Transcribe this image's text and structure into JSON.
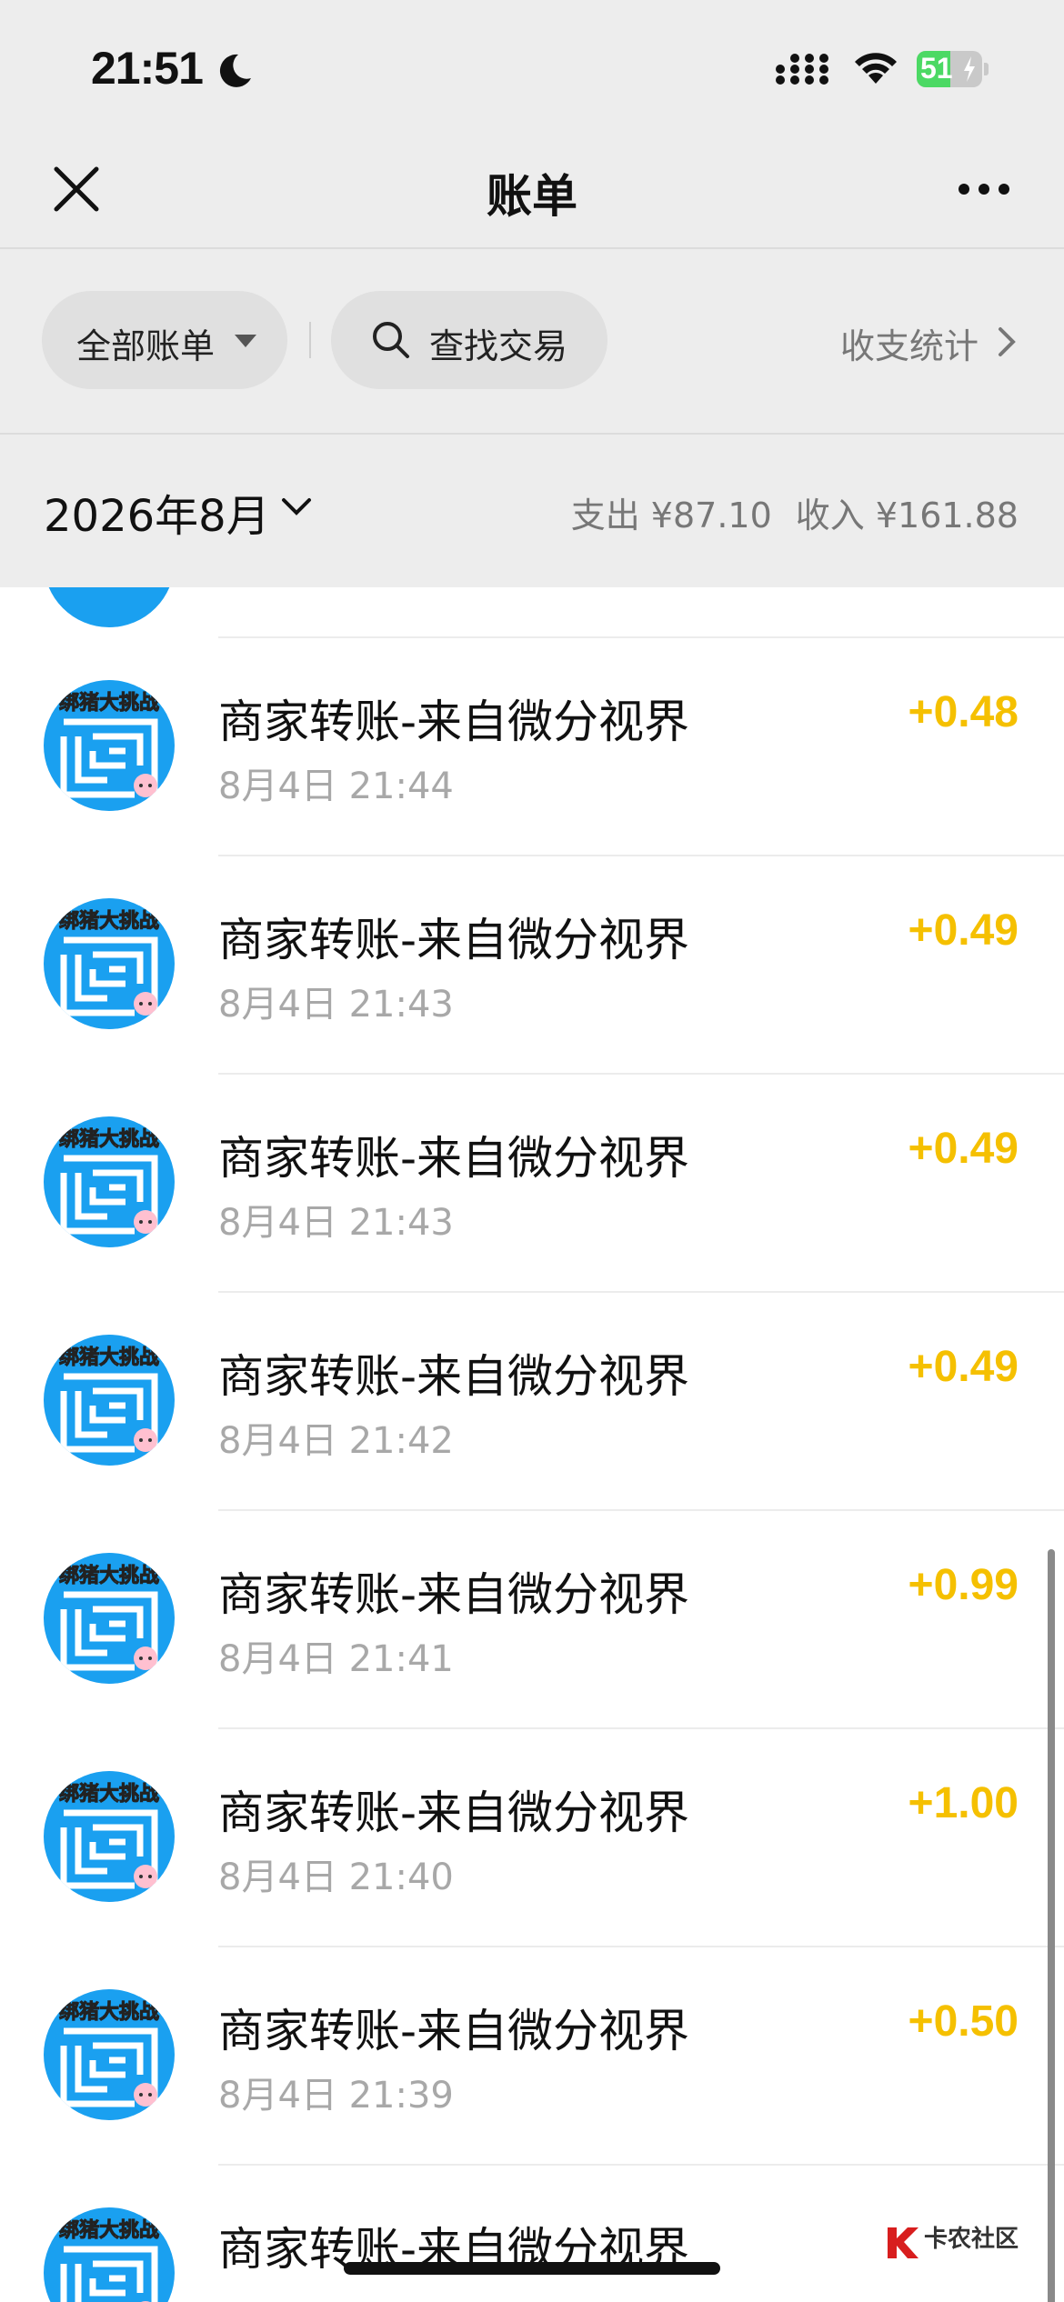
{
  "status": {
    "time": "21:51",
    "battery": "51",
    "battery_level": 0.51
  },
  "nav": {
    "title": "账单"
  },
  "filters": {
    "all_bills": "全部账单",
    "search": "查找交易",
    "stats": "收支统计"
  },
  "month": {
    "label": "2026年8月",
    "expense": "支出 ¥87.10",
    "income": "收入 ¥161.88"
  },
  "transactions": [
    {
      "title": "商家转账-来自微分视界",
      "time": "8月4日 21:44",
      "amount": "+0.48"
    },
    {
      "title": "商家转账-来自微分视界",
      "time": "8月4日 21:43",
      "amount": "+0.49"
    },
    {
      "title": "商家转账-来自微分视界",
      "time": "8月4日 21:43",
      "amount": "+0.49"
    },
    {
      "title": "商家转账-来自微分视界",
      "time": "8月4日 21:42",
      "amount": "+0.49"
    },
    {
      "title": "商家转账-来自微分视界",
      "time": "8月4日 21:41",
      "amount": "+0.99"
    },
    {
      "title": "商家转账-来自微分视界",
      "time": "8月4日 21:40",
      "amount": "+1.00"
    },
    {
      "title": "商家转账-来自微分视界",
      "time": "8月4日 21:39",
      "amount": "+0.50"
    },
    {
      "title": "商家转账-来自微分视界",
      "time": "",
      "amount": ""
    }
  ],
  "avatar_text": "绑猪大挑战",
  "watermark": {
    "text": "卡农社区"
  },
  "colors": {
    "amount": "#f5c000",
    "avatar_blue": "#1aa0f0"
  }
}
